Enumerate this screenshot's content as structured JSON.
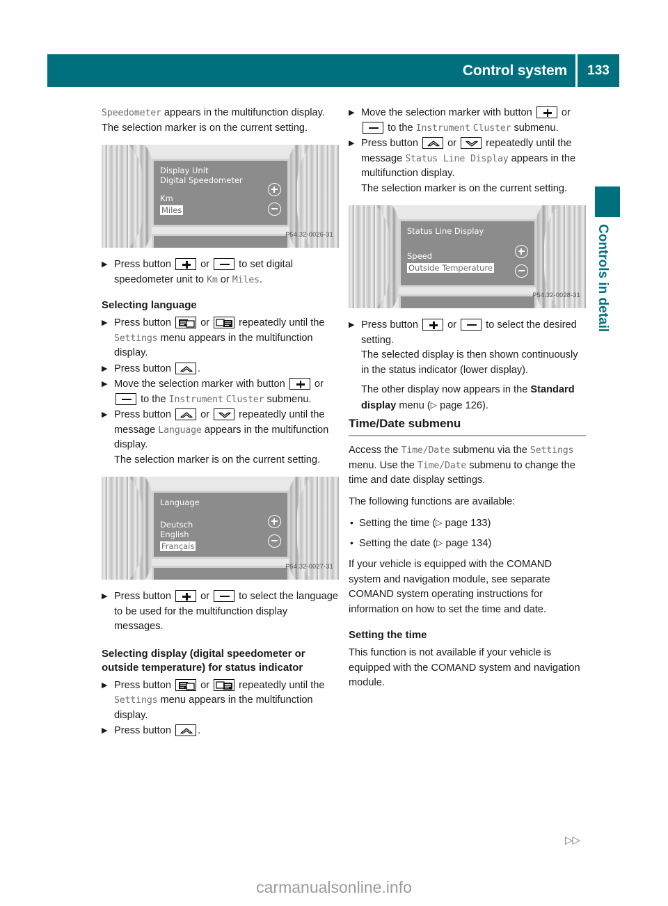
{
  "header": {
    "title": "Control system",
    "page_number": "133",
    "bar_color": "#00707f"
  },
  "side_tab": {
    "label": "Controls in detail",
    "color": "#00707f"
  },
  "left_column": {
    "intro": {
      "term": "Speedometer",
      "rest": " appears in the multifunction display.",
      "line2": "The selection marker is on the current setting."
    },
    "figure1": {
      "line1": "Display Unit",
      "line2": "Digital Speedometer",
      "option1": "Km",
      "option2": "Miles",
      "code": "P54.32-0026-31"
    },
    "step_set_unit": {
      "pre": "Press button",
      "or": "or",
      "mid": "to set digital speedometer unit to",
      "unit1": "Km",
      "conj": "or",
      "unit2": "Miles",
      "end": "."
    },
    "heading_language": "Selecting language",
    "step_settings_menu": {
      "pre": "Press button",
      "or": "or",
      "post": "repeatedly until the",
      "menu": "Settings",
      "end": "menu appears in the multifunction display."
    },
    "step_press_up": {
      "pre": "Press button",
      "end": "."
    },
    "step_move_marker": {
      "pre": "Move the selection marker with button",
      "or": "or",
      "mid": "to the",
      "menu1": "Instrument",
      "menu2": "Cluster",
      "end": "submenu."
    },
    "step_language_msg": {
      "pre": "Press button",
      "or": "or",
      "mid": "repeatedly until the message",
      "menu": "Language",
      "post": "appears in the multifunction display.",
      "line2": "The selection marker is on the current setting."
    },
    "figure2": {
      "line1": "Language",
      "option1": "Deutsch",
      "option2": "English",
      "option3": "Français",
      "code": "P54.32-0027-31"
    },
    "step_select_language": {
      "pre": "Press button",
      "or": "or",
      "end": "to select the language to be used for the multifunction display messages."
    },
    "heading_status_indicator": "Selecting display (digital speedometer or outside temperature) for status indicator",
    "step_settings_menu2": {
      "pre": "Press button",
      "or": "or",
      "post": "repeatedly until the",
      "menu": "Settings",
      "end": "menu appears in the multifunction display."
    },
    "step_press_up2": {
      "pre": "Press button",
      "end": "."
    }
  },
  "right_column": {
    "step_move_marker": {
      "pre": "Move the selection marker with button",
      "or": "or",
      "mid": "to the",
      "menu1": "Instrument",
      "menu2": "Cluster",
      "end": "submenu."
    },
    "step_status_line": {
      "pre": "Press button",
      "or": "or",
      "mid": "repeatedly until the message",
      "menu": "Status Line Display",
      "post": "appears in the multifunction display.",
      "line2": "The selection marker is on the current setting."
    },
    "figure3": {
      "line1": "Status Line Display",
      "option1": "Speed",
      "option2": "Outside Temperature",
      "code": "P54.32-0028-31"
    },
    "step_select_setting": {
      "pre": "Press button",
      "or": "or",
      "end": "to select the desired setting.",
      "line2": "The selected display is then shown continuously in the status indicator (lower display).",
      "line3_a": "The other display now appears in the",
      "line3_bold": "Standard display",
      "line3_b": "menu (",
      "line3_page": "page 126",
      "line3_c": ")."
    },
    "section_heading": "Time/Date submenu",
    "access_para": {
      "a": "Access the",
      "term1": "Time/Date",
      "b": "submenu via the",
      "term2": "Settings",
      "c": "menu. Use the",
      "term3": "Time/Date",
      "d": "submenu to change the time and date display settings."
    },
    "functions_intro": "The following functions are available:",
    "bullets": [
      {
        "text_a": "Setting the time (",
        "page": "page 133",
        "text_b": ")"
      },
      {
        "text_a": "Setting the date (",
        "page": "page 134",
        "text_b": ")"
      }
    ],
    "comand_para": "If your vehicle is equipped with the COMAND system and navigation module, see separate COMAND system operating instructions for information on how to set the time and date.",
    "heading_setting_time": "Setting the time",
    "setting_time_para": "This function is not available if your vehicle is equipped with the COMAND system and navigation module."
  },
  "footer": {
    "continuation_marker": "▷▷",
    "watermark": "carmanualsonline.info"
  },
  "glyphs": {
    "step_marker": "▶",
    "bullet_marker": "•",
    "page_arrow": "▷"
  }
}
